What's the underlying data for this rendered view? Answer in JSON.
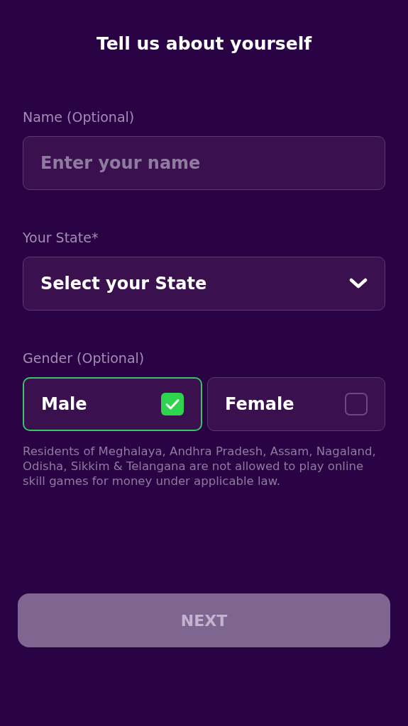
{
  "title": "Tell us about yourself",
  "name_field": {
    "label": "Name (Optional)",
    "placeholder": "Enter your name"
  },
  "state_field": {
    "label": "Your State*",
    "value": "Select your State"
  },
  "gender": {
    "label": "Gender (Optional)",
    "options": [
      {
        "label": "Male",
        "selected": true
      },
      {
        "label": "Female",
        "selected": false
      }
    ]
  },
  "notice": "Residents of Meghalaya, Andhra Pradesh, Assam, Nagaland, Odisha, Sikkim & Telangana are not allowed to play online skill games for money under applicable law.",
  "next_button": {
    "label": "NEXT",
    "disabled": true
  }
}
